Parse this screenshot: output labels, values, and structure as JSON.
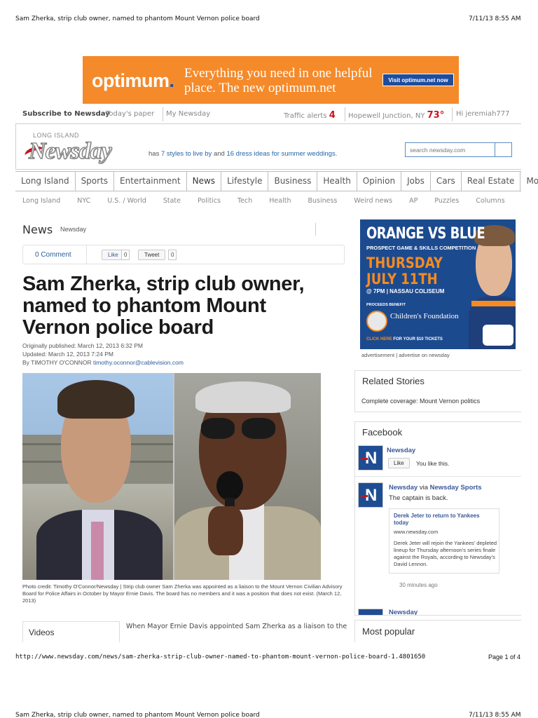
{
  "print_header": {
    "title": "Sam Zherka, strip club owner, named to phantom Mount Vernon police board",
    "timestamp": "7/11/13 8:55 AM"
  },
  "ad_banner": {
    "logo_text": "optimum",
    "logo_dot": ".",
    "tagline": "Everything you need in one helpful place. The new optimum.net",
    "cta": "Visit optimum.net now"
  },
  "utility_bar": {
    "subscribe": "Subscribe to Newsday",
    "todays_paper": "Today's paper",
    "my_newsday": "My Newsday",
    "traffic_label": "Traffic alerts",
    "traffic_count": "4",
    "location": "Hopewell Junction, NY",
    "temperature": "73°",
    "greeting": "Hi jeremiah777"
  },
  "masthead": {
    "region": "LONG ISLAND",
    "logo": "Newsday",
    "promo_prefix": "has ",
    "promo_link1": "7 styles to live by",
    "promo_mid": " and ",
    "promo_link2": "16 dress ideas for summer weddings",
    "promo_suffix": ".",
    "search_placeholder": "search newsday.com"
  },
  "nav": {
    "items": [
      "Long Island",
      "Sports",
      "Entertainment",
      "News",
      "Lifestyle",
      "Business",
      "Health",
      "Opinion",
      "Jobs",
      "Cars",
      "Real Estate",
      "More"
    ],
    "active": "News"
  },
  "subnav": {
    "items": [
      "Long Island",
      "NYC",
      "U.S. / World",
      "State",
      "Politics",
      "Tech",
      "Health",
      "Business",
      "Weird news",
      "AP",
      "Puzzles",
      "Columns"
    ]
  },
  "article": {
    "section": "News",
    "section_sub": "Newsday",
    "comment_count": "0 Comment",
    "like_label": "Like",
    "like_count": "0",
    "tweet_label": "Tweet",
    "tweet_count": "0",
    "headline": "Sam Zherka, strip club owner, named to phantom Mount Vernon police board",
    "published": "Originally published: March 12, 2013 6:32 PM",
    "updated": "Updated: March 12, 2013 7:24 PM",
    "byline": "By TIMOTHY O'CONNOR",
    "email": "timothy.oconnor@cablevision.com",
    "caption": "Photo credit: Timothy O'Connor/Newsday | Strip club owner Sam Zherka was appointed as a liaison to the Mount Vernon Civilian Advisory Board for Police Affairs in October by Mayor Ernie Davis. The board has no members and it was a position that does not exist. (March 12, 2013)",
    "videos_label": "Videos",
    "body_lead": "When Mayor Ernie Davis appointed Sam Zherka as a liaison to the"
  },
  "sidebar_ad": {
    "title": "ORANGE VS BLUE",
    "subtitle": "PROSPECT GAME & SKILLS COMPETITION",
    "day": "THURSDAY",
    "date": "JULY 11TH",
    "time": "@ 7PM | NASSAU COLISEUM",
    "benefit": "PROCEEDS BENEFIT",
    "charity": "Children's Foundation",
    "tickets_link": "CLICK HERE",
    "tickets_text": " FOR YOUR $10 TICKETS",
    "note": "advertisement | advertise on newsday"
  },
  "related": {
    "heading": "Related Stories",
    "item": "Complete coverage: Mount Vernon politics"
  },
  "facebook": {
    "heading": "Facebook",
    "page_name": "Newsday",
    "like_label": "Like",
    "you_like": "You like this.",
    "post_author": "Newsday",
    "post_via": " via ",
    "post_source": "Newsday Sports",
    "post_text": "The captain is back.",
    "card_title": "Derek Jeter to return to Yankees today",
    "card_url": "www.newsday.com",
    "card_desc": "Derek Jeter will rejoin the Yankees' depleted lineup for Thursday afternoon's series finale against the Royals, according to Newsday's David Lennon.",
    "post_time": "30 minutes ago",
    "next_name": "Newsday"
  },
  "most_popular": {
    "heading": "Most popular"
  },
  "print_footer": {
    "url": "http://www.newsday.com/news/sam-zherka-strip-club-owner-named-to-phantom-mount-vernon-police-board-1.4801650",
    "page": "Page 1 of 4"
  },
  "colors": {
    "orange": "#f58a2a",
    "newsday_red": "#d0101d",
    "link_blue": "#2b5d9c",
    "promo_blue": "#1c4a8f"
  }
}
